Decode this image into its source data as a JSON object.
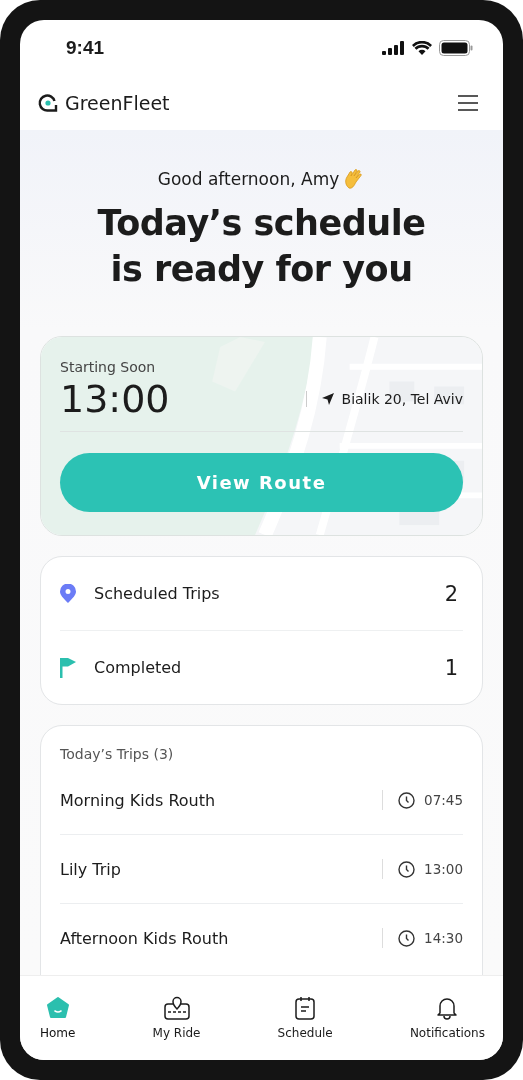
{
  "status_bar": {
    "time": "9:41"
  },
  "header": {
    "brand": "GreenFleet"
  },
  "greeting": "Good afternoon, Amy",
  "headline": [
    "Today’s schedule",
    "is ready for you"
  ],
  "next_trip": {
    "label": "Starting Soon",
    "time": "13:00",
    "address": "Bialik 20, Tel Aviv",
    "button": "View Route"
  },
  "stats": [
    {
      "label": "Scheduled Trips",
      "value": "2",
      "color": "#6b7cf6"
    },
    {
      "label": "Completed",
      "value": "1",
      "color": "#2bbfae"
    }
  ],
  "trips": {
    "title": "Today’s Trips (3)",
    "items": [
      {
        "name": "Morning Kids Routh",
        "time": "07:45"
      },
      {
        "name": "Lily Trip",
        "time": "13:00"
      },
      {
        "name": "Afternoon Kids Routh",
        "time": "14:30"
      }
    ]
  },
  "nav": [
    {
      "label": "Home",
      "selected": true
    },
    {
      "label": "My Ride",
      "selected": false
    },
    {
      "label": "Schedule",
      "selected": false
    },
    {
      "label": "Notifications",
      "selected": false
    }
  ]
}
